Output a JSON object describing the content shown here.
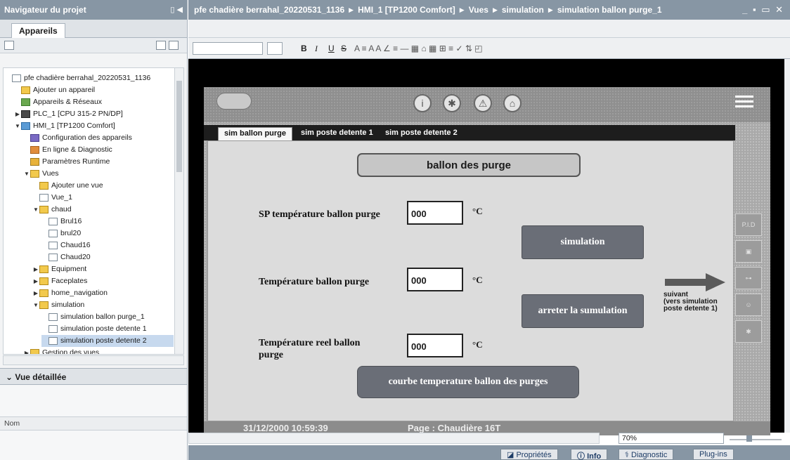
{
  "navigator": {
    "title": "Navigateur du projet",
    "tab": "Appareils",
    "tree": [
      {
        "label": "pfe chadière berrahal_20220531_1136",
        "icon": "project-icon",
        "depth": 0,
        "expander": "",
        "selected": false
      },
      {
        "label": "Ajouter un appareil",
        "icon": "add-device-icon",
        "depth": 1,
        "expander": "",
        "selected": false
      },
      {
        "label": "Appareils & Réseaux",
        "icon": "network-icon",
        "depth": 1,
        "expander": "",
        "selected": false
      },
      {
        "label": "PLC_1 [CPU 315-2 PN/DP]",
        "icon": "plc-icon",
        "depth": 1,
        "expander": "▶",
        "selected": false
      },
      {
        "label": "HMI_1 [TP1200 Comfort]",
        "icon": "hmi-icon",
        "depth": 1,
        "expander": "▼",
        "selected": false
      },
      {
        "label": "Configuration des appareils",
        "icon": "config-icon",
        "depth": 2,
        "expander": "",
        "selected": false
      },
      {
        "label": "En ligne & Diagnostic",
        "icon": "diagnostic-icon",
        "depth": 2,
        "expander": "",
        "selected": false
      },
      {
        "label": "Paramètres Runtime",
        "icon": "runtime-icon",
        "depth": 2,
        "expander": "",
        "selected": false
      },
      {
        "label": "Vues",
        "icon": "folder-icon",
        "depth": 2,
        "expander": "▼",
        "selected": false
      },
      {
        "label": "Ajouter une vue",
        "icon": "add-screen-icon",
        "depth": 3,
        "expander": "",
        "selected": false
      },
      {
        "label": "Vue_1",
        "icon": "screen-icon",
        "depth": 3,
        "expander": "",
        "selected": false
      },
      {
        "label": "chaud",
        "icon": "folder-icon",
        "depth": 3,
        "expander": "▼",
        "selected": false
      },
      {
        "label": "Brul16",
        "icon": "screen-icon",
        "depth": 4,
        "expander": "",
        "selected": false
      },
      {
        "label": "brul20",
        "icon": "screen-icon",
        "depth": 4,
        "expander": "",
        "selected": false
      },
      {
        "label": "Chaud16",
        "icon": "screen-icon",
        "depth": 4,
        "expander": "",
        "selected": false
      },
      {
        "label": "Chaud20",
        "icon": "screen-icon",
        "depth": 4,
        "expander": "",
        "selected": false
      },
      {
        "label": "Equipment",
        "icon": "folder-icon",
        "depth": 3,
        "expander": "▶",
        "selected": false
      },
      {
        "label": "Faceplates",
        "icon": "folder-icon",
        "depth": 3,
        "expander": "▶",
        "selected": false
      },
      {
        "label": "home_navigation",
        "icon": "folder-icon",
        "depth": 3,
        "expander": "▶",
        "selected": false
      },
      {
        "label": "simulation",
        "icon": "folder-icon",
        "depth": 3,
        "expander": "▼",
        "selected": false
      },
      {
        "label": "simulation ballon purge_1",
        "icon": "screen-icon",
        "depth": 4,
        "expander": "",
        "selected": false
      },
      {
        "label": "simulation poste detente 1",
        "icon": "screen-icon",
        "depth": 4,
        "expander": "",
        "selected": false
      },
      {
        "label": "simulation poste detente 2",
        "icon": "screen-icon",
        "depth": 4,
        "expander": "",
        "selected": true
      },
      {
        "label": "Gestion des vues",
        "icon": "folder-icon",
        "depth": 2,
        "expander": "▶",
        "selected": false
      }
    ],
    "detail_title": "Vue détaillée",
    "detail_column": "Nom"
  },
  "breadcrumb": [
    "pfe chadière berrahal_20220531_1136",
    "HMI_1 [TP1200 Comfort]",
    "Vues",
    "simulation",
    "simulation ballon purge_1"
  ],
  "toolbar": {
    "bold": "B",
    "italic": "I",
    "underline": "U",
    "strike": "S"
  },
  "hmi": {
    "tabs": [
      "sim ballon purge",
      "sim poste detente 1",
      "sim poste detente 2"
    ],
    "active_tab": 0,
    "title": "ballon des purge",
    "fields": [
      {
        "label": "SP température ballon purge",
        "value": "000",
        "unit": "°C"
      },
      {
        "label": "Température ballon purge",
        "value": "000",
        "unit": "°C"
      },
      {
        "label": "Température reel ballon purge",
        "value": "000",
        "unit": "°C"
      }
    ],
    "simulation_button": "simulation",
    "stop_button": "arreter la sumulation",
    "curve_button": "courbe temperature ballon des purges",
    "next_text": "suivant\n(vers simulation\nposte detente 1)",
    "side_buttons": [
      "P.I.D",
      "",
      "",
      "",
      ""
    ],
    "date": "31/12/2000 10:59:39",
    "page": "Page : Chaudière 16T"
  },
  "zoom": "70%",
  "bottom_tabs": [
    "Propriétés",
    "Info",
    "Diagnostic",
    "Plug-ins"
  ],
  "colors": {
    "titlebar": "#8796a4",
    "button_dark": "#6a6e77",
    "panel_bg": "#dcdcdc"
  }
}
